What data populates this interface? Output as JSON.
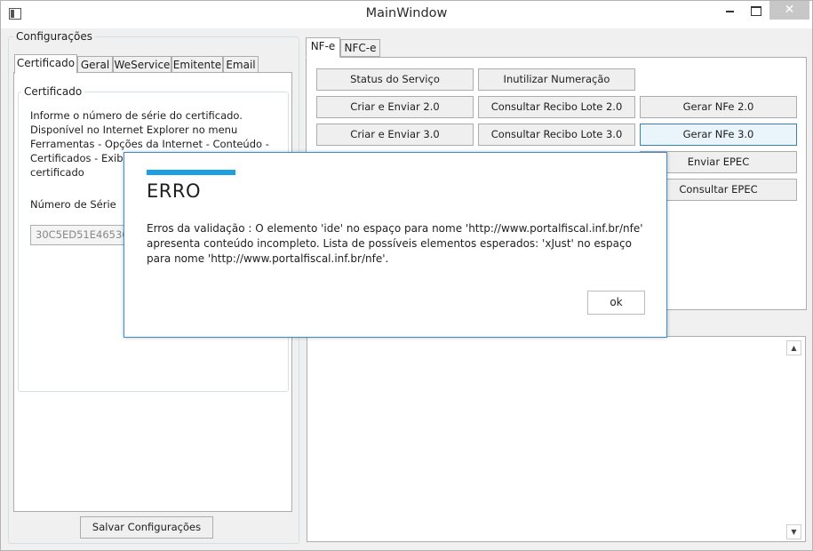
{
  "window": {
    "title": "MainWindow",
    "close_glyph": "✕"
  },
  "config": {
    "group_label": "Configurações",
    "tabs": [
      "Certificado",
      "Geral",
      "WeService",
      "Emitente",
      "Email"
    ],
    "active_tab": "Certificado",
    "cert_group_label": "Certificado",
    "info_lines": [
      "Informe o número de série do certificado.",
      "Disponível no Internet Explorer no menu",
      "Ferramentas - Opções da Internet - Conteúdo -",
      "Certificados - Exibir",
      "certificado"
    ],
    "serial_label": "Número de Série",
    "serial_value": "30C5ED51E46536F",
    "save_label": "Salvar Configurações"
  },
  "main": {
    "tabs": [
      "NF-e",
      "NFC-e"
    ],
    "active_tab": "NF-e",
    "buttons": {
      "status_servico": "Status do Serviço",
      "inutilizar": "Inutilizar Numeração",
      "criar_enviar_20": "Criar e Enviar 2.0",
      "consultar_recibo_20": "Consultar Recibo Lote 2.0",
      "gerar_nfe_20": "Gerar NFe 2.0",
      "criar_enviar_30": "Criar e Enviar 3.0",
      "consultar_recibo_30": "Consultar Recibo Lote 3.0",
      "gerar_nfe_30": "Gerar NFe 3.0",
      "enviar_epec": "Enviar EPEC",
      "consultar_epec": "Consultar EPEC"
    }
  },
  "dialog": {
    "title": "ERRO",
    "message": "Erros da validação : O elemento 'ide' no espaço para nome 'http://www.portalfiscal.inf.br/nfe' apresenta conteúdo incompleto. Lista de possíveis elementos esperados: 'xJust' no espaço para nome 'http://www.portalfiscal.inf.br/nfe'.",
    "ok_label": "ok",
    "accent_color": "#1ba1e2"
  }
}
